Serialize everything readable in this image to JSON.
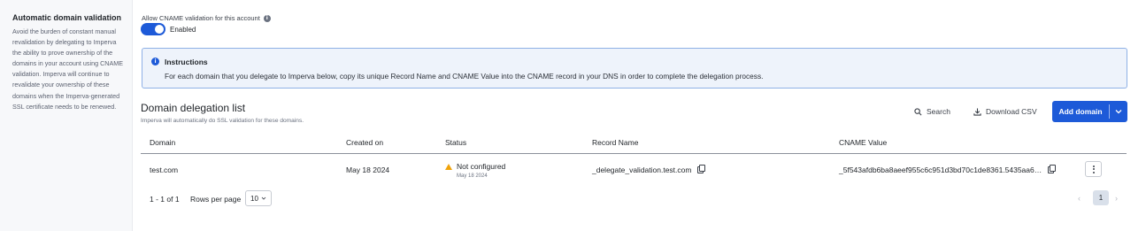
{
  "sidebar": {
    "title": "Automatic domain validation",
    "description": "Avoid the burden of constant manual revalidation by delegating to Imperva the ability to prove ownership of the domains in your account using CNAME validation. Imperva will continue to revalidate your ownership of these domains when the Imperva-generated SSL certificate needs to be renewed."
  },
  "cname_setting": {
    "label": "Allow CNAME validation for this account",
    "info_icon": "info-icon",
    "toggle_state": "on",
    "toggle_label": "Enabled"
  },
  "instructions": {
    "icon": "info-icon",
    "title": "Instructions",
    "text": "For each domain that you delegate to Imperva below, copy its unique Record Name and CNAME Value into the CNAME record in your DNS in order to complete the delegation process."
  },
  "list": {
    "title": "Domain delegation list",
    "subtitle": "Imperva will automatically do SSL validation for these domains.",
    "search_label": "Search",
    "download_label": "Download CSV",
    "add_label": "Add domain",
    "accent": "#1d5ad8"
  },
  "table": {
    "headers": {
      "domain": "Domain",
      "created": "Created on",
      "status": "Status",
      "record": "Record Name",
      "cname": "CNAME Value"
    },
    "rows": [
      {
        "domain": "test.com",
        "created": "May 18 2024",
        "status": "Not configured",
        "status_date": "May 18 2024",
        "status_color": "#f0a30a",
        "record": "_delegate_validation.test.com",
        "cname": "_5f543afdb6ba8aeef955c6c951d3bd70c1de8361.5435aa6…"
      }
    ]
  },
  "pagination": {
    "range": "1 - 1 of 1",
    "rows_per_page_label": "Rows per page",
    "rows_per_page": "10",
    "current_page": "1",
    "prev": "‹",
    "next": "›"
  }
}
